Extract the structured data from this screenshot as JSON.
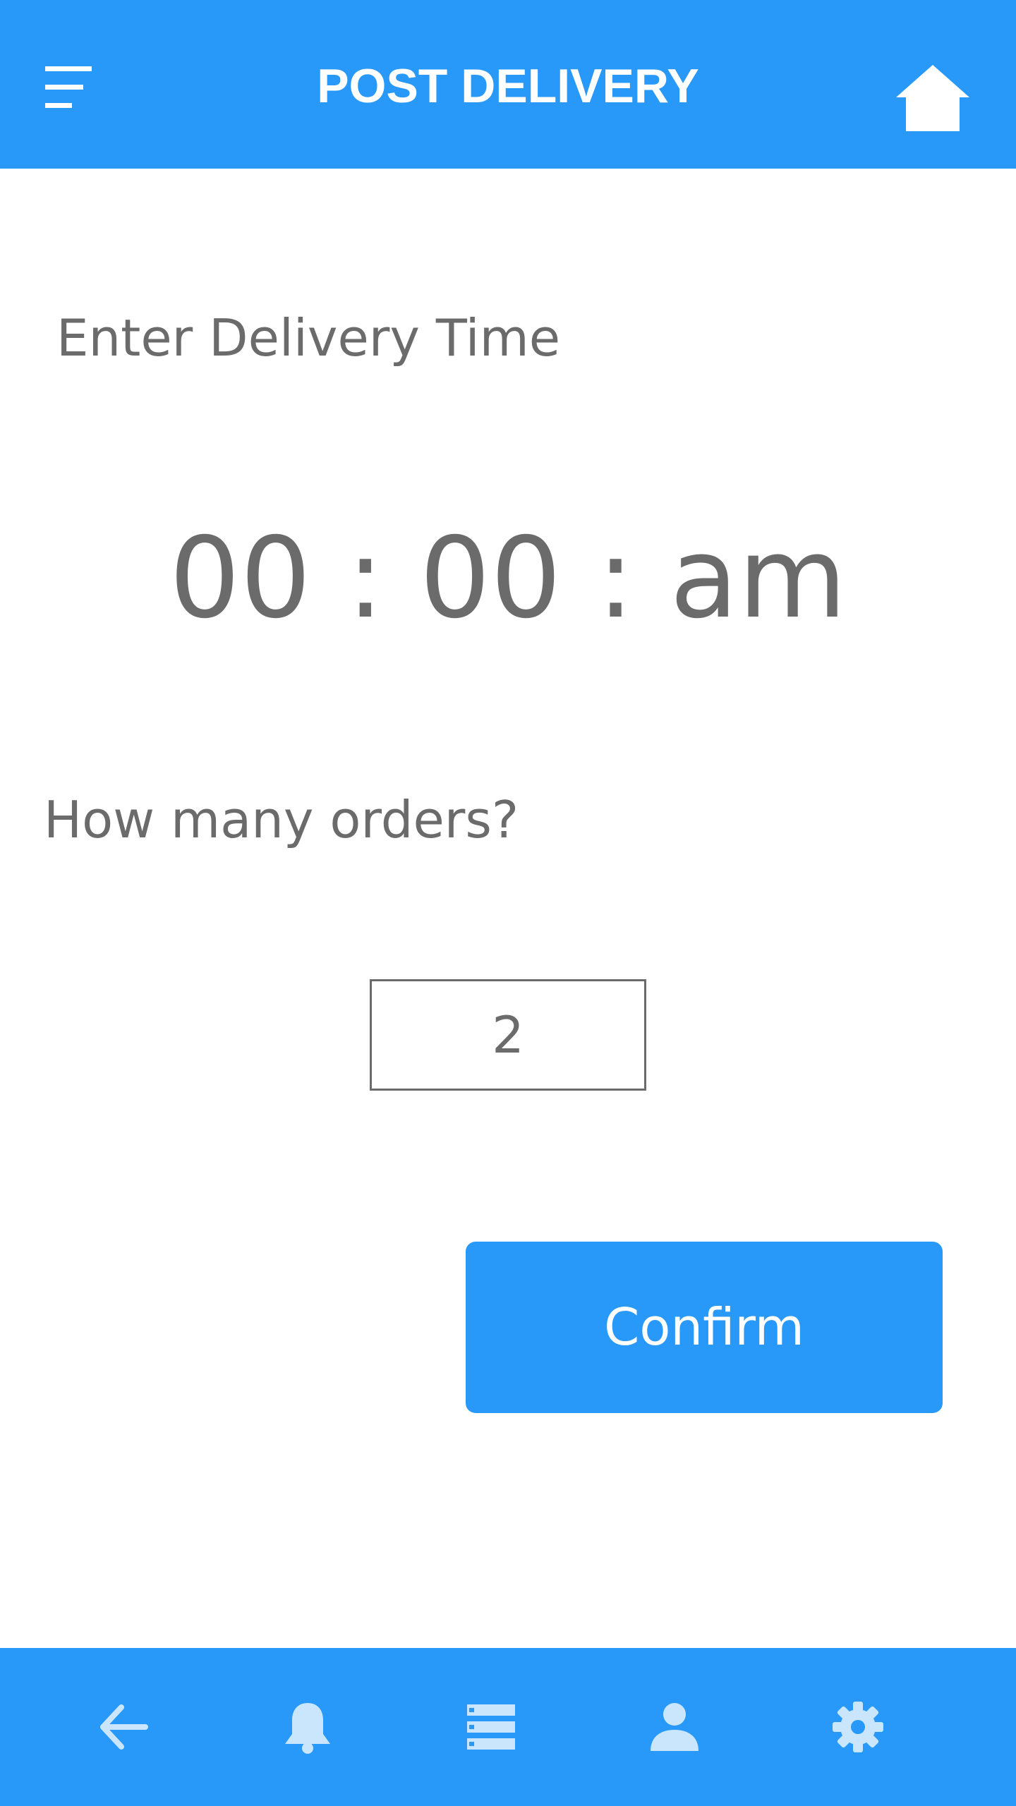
{
  "colors": {
    "primary": "#2899f9",
    "text": "#6b6b6b",
    "nav_icon": "#c9e6fd",
    "background": "#ffffff"
  },
  "header": {
    "title": "POST DELIVERY",
    "left_icon": "menu-icon",
    "right_icon": "home-icon"
  },
  "form": {
    "time_label": "Enter Delivery Time",
    "time_value": "00 : 00 : am",
    "orders_label": "How many orders?",
    "orders_value": "2",
    "confirm_label": "Confirm"
  },
  "bottom_nav": {
    "items": [
      {
        "icon": "arrow-left-icon"
      },
      {
        "icon": "bell-icon"
      },
      {
        "icon": "list-icon"
      },
      {
        "icon": "user-icon"
      },
      {
        "icon": "gear-icon"
      }
    ]
  }
}
